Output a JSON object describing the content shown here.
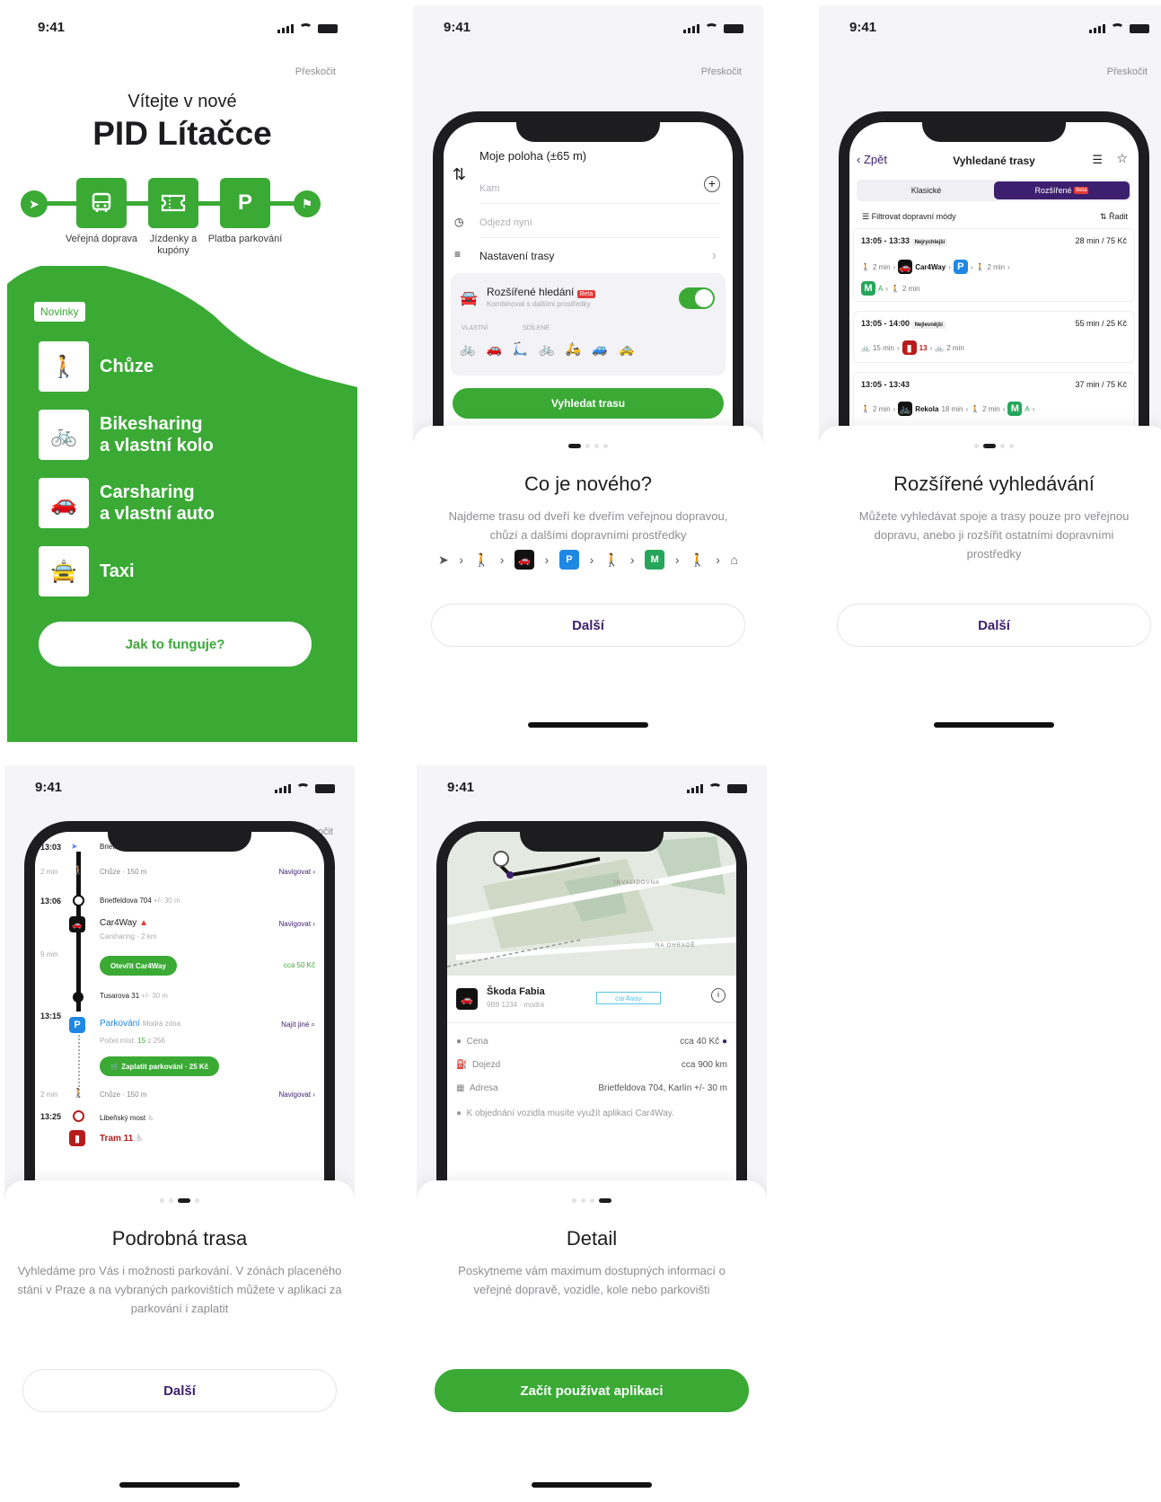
{
  "status_time": "9:41",
  "skip_label": "Přeskočit",
  "next_label": "Další",
  "s1": {
    "welcome": "Vítejte v nové",
    "brand": "PID Lítačce",
    "flow": [
      {
        "icon": "bus-icon",
        "label": "Veřejná doprava"
      },
      {
        "icon": "ticket-icon",
        "label": "Jízdenky a kupóny"
      },
      {
        "icon": "parking-icon",
        "label": "Platba parkování",
        "glyph": "P"
      }
    ],
    "badge": "Novinky",
    "features": [
      {
        "icon": "walk-icon",
        "label": "Chůze"
      },
      {
        "icon": "bike-icon",
        "label": "Bikesharing",
        "label2": "a vlastní kolo"
      },
      {
        "icon": "car-icon",
        "label": "Carsharing",
        "label2": "a vlastní auto"
      },
      {
        "icon": "taxi-icon",
        "label": "Taxi"
      }
    ],
    "cta": "Jak to funguje?",
    "color_green": "#3aaa35"
  },
  "s2": {
    "from": "Moje poloha (±65 m)",
    "to_placeholder": "Kam",
    "depart_placeholder": "Odjezd nyní",
    "settings": "Nastavení trasy",
    "extended_title": "Rozšířené hledání",
    "beta": "Beta",
    "extended_sub": "Kombinovat s dalšími prostředky",
    "own": "VLASTNÍ",
    "shared": "SDÍLENÉ",
    "search_btn": "Vyhledat trasu",
    "title": "Co je nového?",
    "desc": "Najdeme trasu od dveří ke dveřím veřejnou dopravou, chůzí a dalšími dopravními prostředky"
  },
  "s3": {
    "back": "Zpět",
    "nav_title": "Vyhledané trasy",
    "tab_classic": "Klasické",
    "tab_extended": "Rozšířené",
    "beta": "Beta",
    "filter": "Filtrovat dopravní módy",
    "sort": "Řadit",
    "routes": [
      {
        "time": "13:05 - 13:33",
        "tag": "Nejrychlejší",
        "info": "28 min / 75 Kč",
        "l1": "2 min",
        "brand": "Car4Way",
        "l1b": "2 min",
        "l2a": "A",
        "l2b": "2 min"
      },
      {
        "time": "13:05 - 14:00",
        "tag": "Nejlevnější",
        "info": "55 min / 25 Kč",
        "l1": "15 min",
        "line": "13",
        "l1b": "2 min"
      },
      {
        "time": "13:05 - 13:43",
        "info": "37 min / 75 Kč",
        "l1": "2 min",
        "brand": "Rekola",
        "brand_min": "18 min",
        "l1b": "2 min",
        "l2a": "A"
      }
    ],
    "title": "Rozšířené vyhledávání",
    "desc": "Můžete vyhledávat spoje a trasy pouze pro veřejnou dopravu, anebo ji rozšířit ostatními dopravními prostředky"
  },
  "s4": {
    "t1": "13:03",
    "st1": "Brietfeldova",
    "st1b": "poloha",
    "walk1_dur": "2 min",
    "walk1": "Chůze · 150 m",
    "nav": "Navigovat",
    "t2": "13:06",
    "st2": "Brietfeldova 704",
    "st2acc": "+/- 30 m",
    "car": "Car4Way",
    "car_sub": "Carsharing · 2 km",
    "car_dur": "9 min",
    "open_car": "Otevřít Car4Way",
    "car_price": "cca 50 Kč",
    "st3": "Tusarova 31",
    "st3acc": "+/- 30 m",
    "t3": "13:15",
    "park": "Parkování",
    "zone": "Modrá zóna",
    "find_other": "Najít jiné",
    "spots_label": "Počet míst:",
    "spots_free": "15",
    "spots_total": "z 256",
    "pay": "Zaplatit parkování · 25 Kč",
    "walk2_dur": "2 min",
    "walk2": "Chůze · 150 m",
    "t4": "13:25",
    "st4": "Libeňský most",
    "tram": "Tram 11",
    "title": "Podrobná trasa",
    "desc": "Vyhledáme pro Vás i možnosti parkování. V zónách placeného stání v Praze a na vybraných parkovištích můžete v aplikaci za parkování i zaplatit"
  },
  "s5": {
    "map_street1": "INVALIDOVNA",
    "map_street2": "NA OHRADĚ",
    "car_name": "Škoda Fabia",
    "car_plate": "9B9 1234 · modrá",
    "car_brand": "car4way",
    "rows": [
      {
        "icon": "coin-icon",
        "label": "Cena",
        "value": "cca 40 Kč"
      },
      {
        "icon": "fuel-icon",
        "label": "Dojezd",
        "value": "cca 900 km"
      },
      {
        "icon": "map-icon",
        "label": "Adresa",
        "value": "Brietfeldova 704, Karlín  +/- 30 m"
      }
    ],
    "note": "K objednání vozidla musíte využít aplikaci Car4Way.",
    "title": "Detail",
    "desc": "Poskytneme vám maximum dostupných informací o veřejné dopravě, vozidle, kole nebo parkovišti",
    "start": "Začít používat aplikaci"
  }
}
